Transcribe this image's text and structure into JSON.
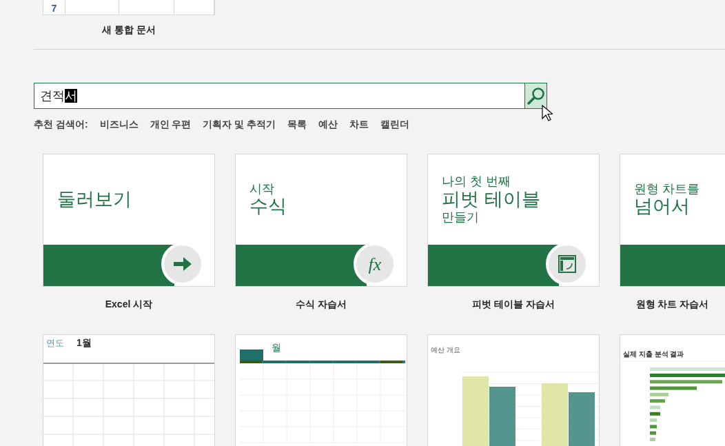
{
  "top_template": {
    "row_label": "7",
    "caption": "새 통합 문서"
  },
  "search": {
    "typed_text": "견적",
    "composing_text": "서"
  },
  "suggestions": {
    "label": "추천 검색어:",
    "items": [
      "비즈니스",
      "개인 우편",
      "기획자 및 추적기",
      "목록",
      "예산",
      "차트",
      "캘린더"
    ]
  },
  "featured": [
    {
      "lines": [
        {
          "text": "둘러보기",
          "emphasized": true
        }
      ],
      "badge": {
        "kind": "arrow"
      },
      "caption": "Excel 시작"
    },
    {
      "lines": [
        {
          "text": "시작",
          "emphasized": false
        },
        {
          "text": "수식",
          "emphasized": true
        }
      ],
      "badge": {
        "kind": "text",
        "text": "fx"
      },
      "caption": "수식 자습서"
    },
    {
      "lines": [
        {
          "text": "나의 첫 번째",
          "emphasized": false
        },
        {
          "text": "피벗 테이블",
          "emphasized": true
        },
        {
          "text": "만들기",
          "emphasized": false
        }
      ],
      "badge": {
        "kind": "pivot"
      },
      "caption": "피벗 테이블 자습서"
    },
    {
      "lines": [
        {
          "text": "원형 차트를",
          "emphasized": false
        },
        {
          "text": "넘어서",
          "emphasized": true
        }
      ],
      "badge": {
        "kind": "none"
      },
      "caption": "원형 차트 자습서"
    }
  ],
  "templates": [
    {
      "kind": "calendar-grid",
      "title": "연도",
      "subtitle": "1월"
    },
    {
      "kind": "calendar-tabbed",
      "subtitle": "월"
    },
    {
      "kind": "column-chart",
      "title": "예산 개요"
    },
    {
      "kind": "expense-bars",
      "title": "실제 지출 분석 결과"
    }
  ]
}
